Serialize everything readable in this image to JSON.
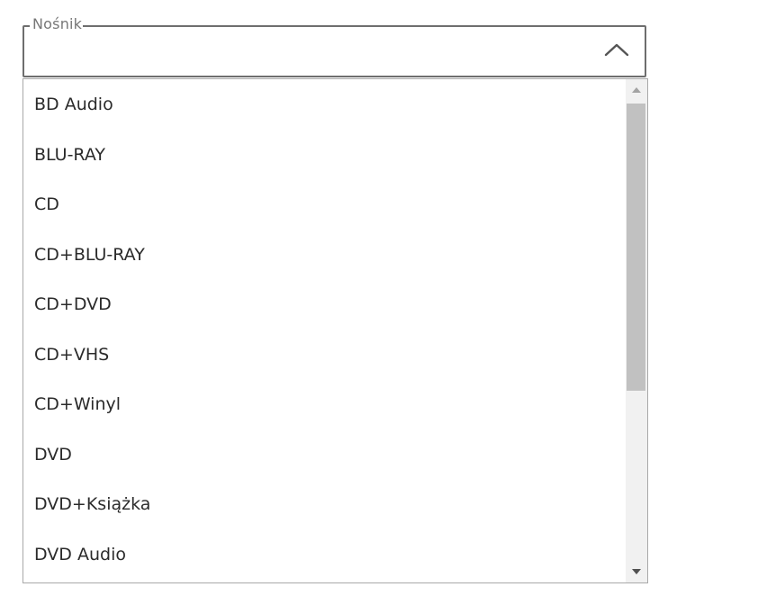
{
  "select": {
    "label": "Nośnik",
    "value": "",
    "expanded": true,
    "toggle_icon": "chevron-up-icon"
  },
  "dropdown": {
    "options": [
      {
        "label": "BD Audio"
      },
      {
        "label": "BLU-RAY"
      },
      {
        "label": "CD"
      },
      {
        "label": "CD+BLU-RAY"
      },
      {
        "label": "CD+DVD"
      },
      {
        "label": "CD+VHS"
      },
      {
        "label": "CD+Winyl"
      },
      {
        "label": "DVD"
      },
      {
        "label": "DVD+Książka"
      },
      {
        "label": "DVD Audio"
      }
    ],
    "scroll_position": 0,
    "visible_fraction": 0.6
  },
  "colors": {
    "border": "#6e6e6e",
    "label_text": "#777777",
    "option_text": "#2b2b2b",
    "scrollbar_track": "#f1f1f1",
    "scrollbar_thumb": "#c1c1c1"
  }
}
